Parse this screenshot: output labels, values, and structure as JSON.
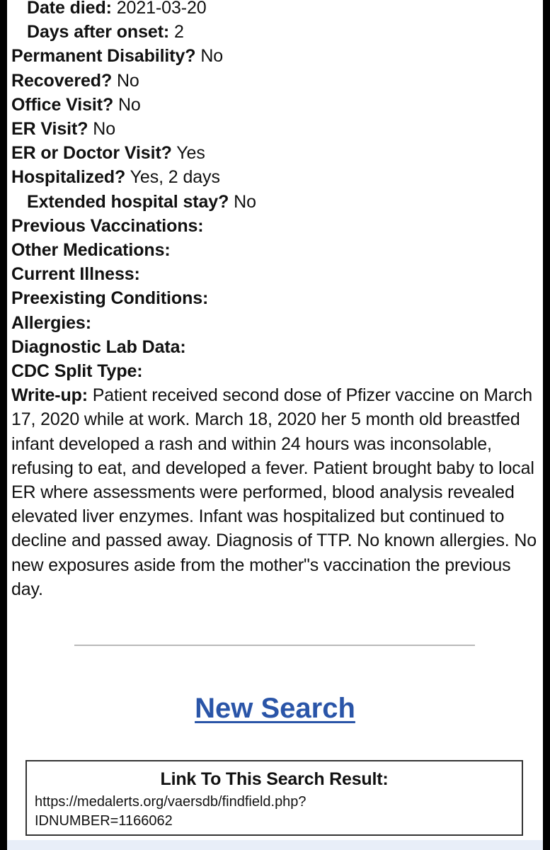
{
  "record": {
    "date_died": {
      "label": "Date died:",
      "value": " 2021-03-20"
    },
    "days_after_onset": {
      "label": "Days after onset:",
      "value": " 2"
    },
    "permanent_disability": {
      "label": "Permanent Disability?",
      "value": " No"
    },
    "recovered": {
      "label": "Recovered?",
      "value": " No"
    },
    "office_visit": {
      "label": "Office Visit?",
      "value": " No"
    },
    "er_visit": {
      "label": "ER Visit?",
      "value": " No"
    },
    "er_or_doctor_visit": {
      "label": "ER or Doctor Visit?",
      "value": " Yes"
    },
    "hospitalized": {
      "label": "Hospitalized?",
      "value": " Yes, 2 days"
    },
    "extended_hospital_stay": {
      "label": "Extended hospital stay?",
      "value": " No"
    },
    "previous_vaccinations": {
      "label": "Previous Vaccinations:"
    },
    "other_medications": {
      "label": "Other Medications:"
    },
    "current_illness": {
      "label": "Current Illness:"
    },
    "preexisting_conditions": {
      "label": "Preexisting Conditions:"
    },
    "allergies": {
      "label": "Allergies:"
    },
    "diagnostic_lab_data": {
      "label": "Diagnostic Lab Data:"
    },
    "cdc_split_type": {
      "label": "CDC Split Type:"
    },
    "writeup": {
      "label": "Write-up:",
      "text": " Patient received second dose of Pfizer vaccine on March 17, 2020 while at work. March 18, 2020 her 5 month old breastfed infant developed a rash and within 24 hours was inconsolable, refusing to eat, and developed a fever. Patient brought baby to local ER where assessments were performed, blood analysis revealed elevated liver enzymes. Infant was hospitalized but continued to decline and passed away. Diagnosis of TTP. No known allergies. No new exposures aside from the mother\"s vaccination the previous day."
    }
  },
  "new_search": {
    "label": "New Search"
  },
  "link_box": {
    "title": "Link To This Search Result:",
    "url_line1": "https://medalerts.org/vaersdb/findfield.php?",
    "url_line2": "IDNUMBER=1166062"
  },
  "colors": {
    "link_blue": "#2a55a8",
    "page_bg": "#ffffff",
    "frame_bg": "#000000"
  }
}
